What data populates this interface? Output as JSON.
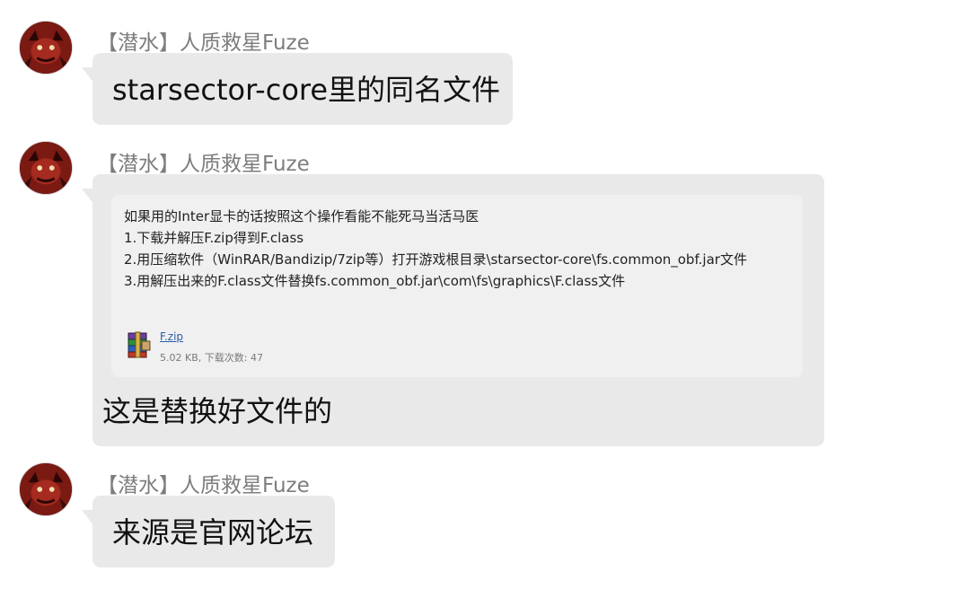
{
  "messages": [
    {
      "sender": "【潜水】人质救星Fuze",
      "text": "starsector-core里的同名文件"
    },
    {
      "sender": "【潜水】人质救星Fuze",
      "quote": {
        "lines": [
          "如果用的Inter显卡的话按照这个操作看能不能死马当活马医",
          "1.下载并解压F.zip得到F.class",
          "2.用压缩软件（WinRAR/Bandizip/7zip等）打开游戏根目录\\starsector-core\\fs.common_obf.jar文件",
          "3.用解压出来的F.class文件替换fs.common_obf.jar\\com\\fs\\graphics\\F.class文件"
        ],
        "attachment": {
          "name": "F.zip",
          "meta": "5.02 KB, 下载次数: 47",
          "icon": "winrar-archive-icon"
        }
      },
      "text": "这是替换好文件的"
    },
    {
      "sender": "【潜水】人质救星Fuze",
      "text": "来源是官网论坛"
    }
  ],
  "colors": {
    "bubble": "#e9e9e9",
    "card": "#f0f0f0",
    "sender": "#7d7d7d",
    "link": "#2a5ca8"
  }
}
